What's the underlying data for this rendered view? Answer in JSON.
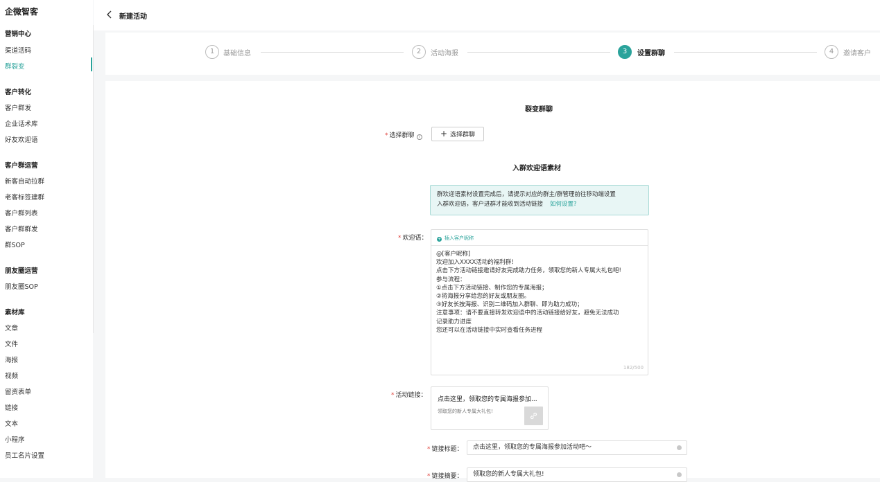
{
  "app": {
    "brand": "企微智客"
  },
  "sidebar": {
    "groups": [
      {
        "title": "营销中心",
        "items": [
          "渠道活码",
          "群裂变"
        ]
      },
      {
        "title": "客户转化",
        "items": [
          "客户群发",
          "企业话术库",
          "好友欢迎语"
        ]
      },
      {
        "title": "客户群运营",
        "items": [
          "新客自动拉群",
          "老客标签建群",
          "客户群列表",
          "客户群群发",
          "群SOP"
        ]
      },
      {
        "title": "朋友圈运营",
        "items": [
          "朋友圈SOP"
        ]
      },
      {
        "title": "素材库",
        "items": [
          "文章",
          "文件",
          "海报",
          "视频",
          "留资表单",
          "链接",
          "文本",
          "小程序",
          "员工名片设置"
        ]
      }
    ],
    "active_item": "群裂变",
    "accent_color": "#2aa39b"
  },
  "header": {
    "back_icon": "chevron-left-icon",
    "title": "新建活动"
  },
  "steps": [
    {
      "num": "1",
      "label": "基础信息",
      "active": false
    },
    {
      "num": "2",
      "label": "活动海报",
      "active": false
    },
    {
      "num": "3",
      "label": "设置群聊",
      "active": true
    },
    {
      "num": "4",
      "label": "邀请客户",
      "active": false
    }
  ],
  "form": {
    "section1_title": "裂变群聊",
    "select_group_label": "选择群聊",
    "select_group_button": "选择群聊",
    "section2_title": "入群欢迎语素材",
    "notice_text_1": "群欢迎语素材设置完成后，请提示对应的群主/群管理前往移动端设置",
    "notice_text_2": "入群欢迎语，客户进群才能收到活动链接",
    "notice_link": "如何设置?",
    "welcome_label": "欢迎语：",
    "insert_nickname": "插入客户昵称",
    "welcome_lines": [
      "@[客户昵称]",
      "欢迎加入XXXX活动的福利群！",
      "点击下方活动链接邀请好友完成助力任务，领取您的新人专属大礼包吧!",
      "参与流程：",
      "①点击下方活动链接、制作您的专属海报；",
      "②将海报分享给您的好友或朋友圈。",
      "③好友长按海报、识别二维码加入群聊、即为助力成功；",
      "注意事项：请不要直接转发欢迎语中的活动链接给好友，避免无法成功",
      "记录助力进度",
      "您还可以在活动链接中实时查看任务进程"
    ],
    "welcome_count": "182/500",
    "activity_link_label": "活动链接：",
    "link_card_title": "点击这里，领取您的专属海报参加...",
    "link_card_desc": "领取您的新人专属大礼包!",
    "link_title_label": "链接标题：",
    "link_title_value": "点击这里，领取您的专属海报参加活动吧～",
    "link_desc_label": "链接摘要：",
    "link_desc_value": "领取您的新人专属大礼包!"
  }
}
